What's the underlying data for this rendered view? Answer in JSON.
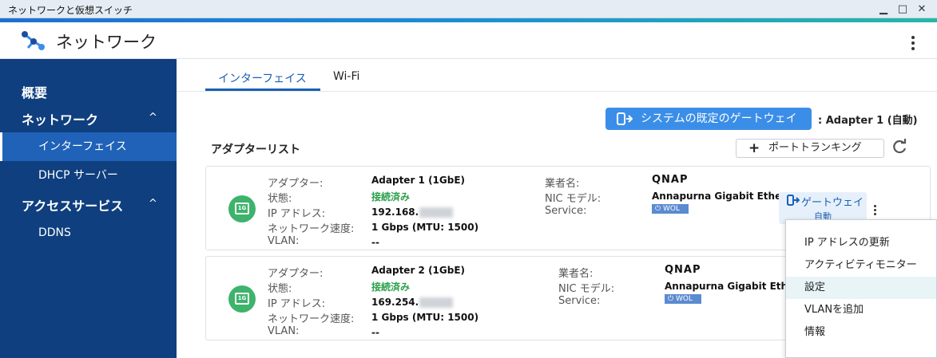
{
  "window": {
    "title": "ネットワークと仮想スイッチ",
    "minimize": "▁",
    "maximize": "□",
    "close": "✕"
  },
  "app": {
    "title": "ネットワーク"
  },
  "sidebar": {
    "overview": "概要",
    "network": "ネットワーク",
    "network_items": [
      "インターフェイス",
      "DHCP サーバー"
    ],
    "access": "アクセスサービス",
    "access_items": [
      "DDNS"
    ],
    "chevron": "^"
  },
  "tabs": [
    "インターフェイス",
    "Wi-Fi"
  ],
  "gateway": {
    "button_label": "システムの既定のゲートウェイ",
    "value": ": Adapter 1 (自動)"
  },
  "adapter_list": {
    "title": "アダプターリスト",
    "trunk_button": "ポートトランキング",
    "labels": {
      "adapter": "アダプター:",
      "status": "状態:",
      "ip": "IP アドレス:",
      "speed": "ネットワーク速度:",
      "vlan": "VLAN:",
      "vendor": "業者名:",
      "nic": "NIC モデル:",
      "service": "Service:"
    },
    "adapters": [
      {
        "badge": "1G",
        "name": "Adapter 1 (1GbE)",
        "status": "接続済み",
        "ip": "192.168.",
        "speed": "1 Gbps (MTU: 1500)",
        "vlan": "--",
        "vendor": "QNAP",
        "nic": "Annapurna Gigabit Ethern",
        "service": "WOL",
        "gateway_label": "ゲートウェイ",
        "gateway_sub": "自動"
      },
      {
        "badge": "1G",
        "name": "Adapter 2 (1GbE)",
        "status": "接続済み",
        "ip": "169.254.",
        "speed": "1 Gbps (MTU: 1500)",
        "vlan": "--",
        "vendor": "QNAP",
        "nic": "Annapurna Gigabit Ethern",
        "service": "WOL"
      }
    ]
  },
  "context_menu": [
    "IP アドレスの更新",
    "アクティビティモニター",
    "設定",
    "VLANを追加",
    "情報"
  ],
  "colors": {
    "sidebar_bg": "#0f3f7e",
    "sidebar_active": "#1f62b8",
    "accent": "#1a5fb4",
    "button_blue": "#3b8ee8",
    "connected_green": "#2aa04a"
  }
}
